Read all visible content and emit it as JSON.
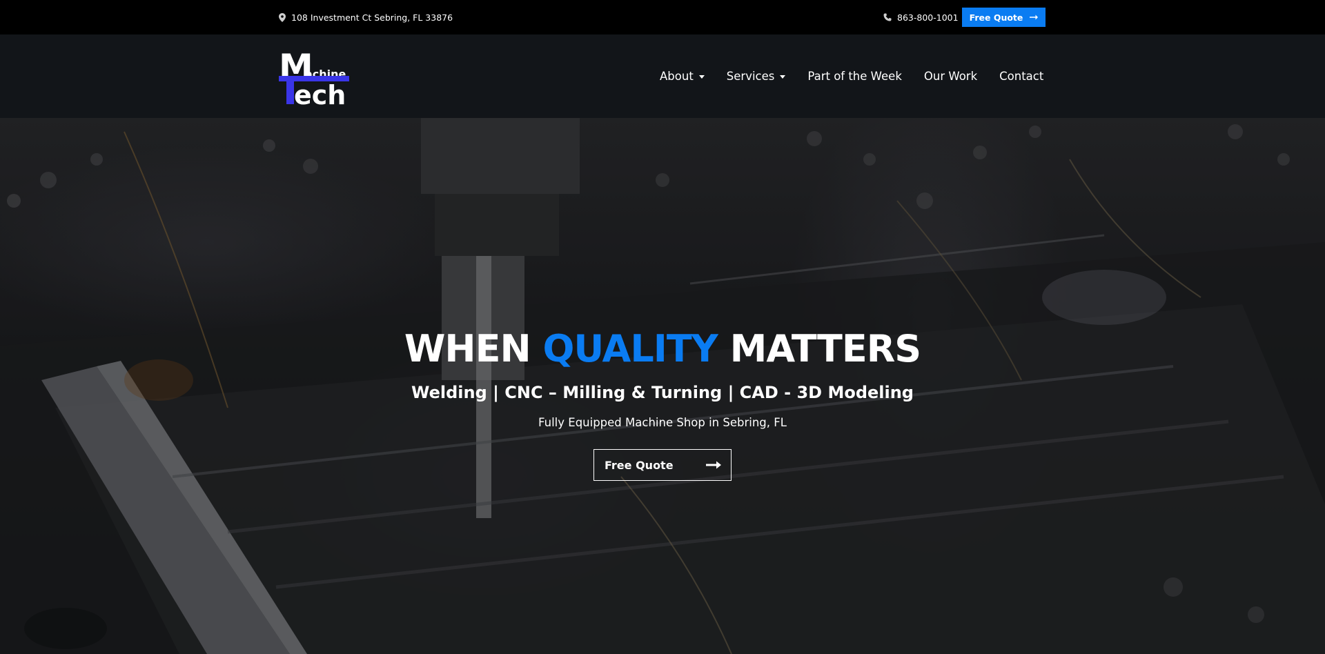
{
  "topbar": {
    "address": "108 Investment Ct Sebring, FL 33876",
    "phone": "863-800-1001",
    "quote_label": "Free Quote",
    "icons": [
      "map-pin-icon",
      "phone-icon",
      "arrow-right-icon"
    ]
  },
  "logo": {
    "line1_big": "M",
    "line1_small": "achine",
    "line2_big": "T",
    "line2_small": "ech",
    "accent_color": "#3a35e8"
  },
  "nav": {
    "items": [
      {
        "label": "About",
        "has_dropdown": true
      },
      {
        "label": "Services",
        "has_dropdown": true
      },
      {
        "label": "Part of the Week",
        "has_dropdown": false
      },
      {
        "label": "Our Work",
        "has_dropdown": false
      },
      {
        "label": "Contact",
        "has_dropdown": false
      }
    ]
  },
  "hero": {
    "title_part1": "WHEN ",
    "title_accent": "QUALITY",
    "title_part2": " MATTERS",
    "subtitle": "Welding | CNC – Milling & Turning | CAD - 3D Modeling",
    "tagline": "Fully Equipped Machine Shop in Sebring, FL",
    "button_label": "Free Quote"
  },
  "colors": {
    "accent": "#0a7cf2",
    "header_bg": "#121519",
    "topbar_bg": "#000000"
  }
}
